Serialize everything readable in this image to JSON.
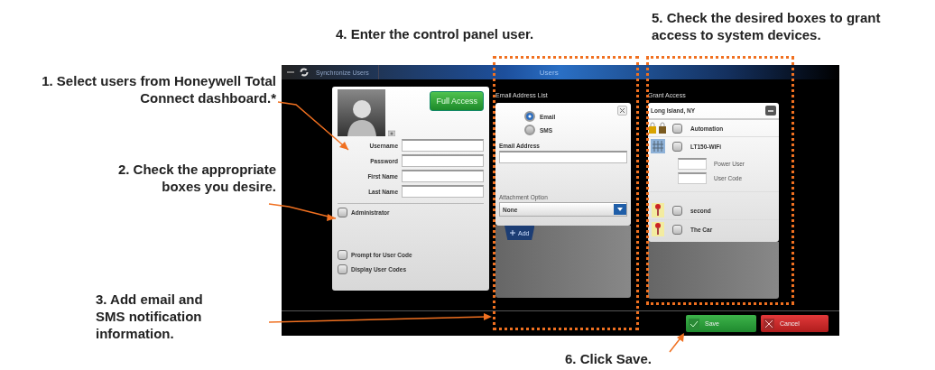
{
  "callouts": [
    {
      "text": "1. Select users from Honeywell Total Connect dashboard.*"
    },
    {
      "text": "2. Check the appropriate boxes you desire."
    },
    {
      "text": "3. Add email and SMS notification information."
    },
    {
      "text": "4. Enter the control panel user."
    },
    {
      "text": "5. Check the desired boxes to grant access to system devices."
    },
    {
      "text": "6. Click Save."
    }
  ],
  "screen": {
    "title_bar": {
      "tab": "Synchronize Users",
      "title": "Users"
    },
    "user_panel": {
      "access_button": "Full Access",
      "fields": [
        {
          "label": "Username"
        },
        {
          "label": "Password"
        },
        {
          "label": "First Name"
        },
        {
          "label": "Last Name"
        }
      ],
      "checkboxes": [
        {
          "label": "Administrator",
          "checked": false
        },
        {
          "label": "Prompt for User Code",
          "checked": false
        },
        {
          "label": "Display User Codes",
          "checked": false
        }
      ]
    },
    "email_panel": {
      "heading": "Email Address List",
      "radios": [
        {
          "label": "Email",
          "selected": true
        },
        {
          "label": "SMS",
          "selected": false
        }
      ],
      "address_label": "Email Address",
      "attachment_label": "Attachment Option",
      "attachment_value": "None",
      "add_button": "Add"
    },
    "grant_panel": {
      "heading": "Grant Access",
      "location": "Long Island, NY",
      "devices": [
        {
          "kind": "lock",
          "name": "Automation",
          "checked": false
        },
        {
          "kind": "keypad",
          "name": "LT150-WiFi",
          "checked": false,
          "inputs": [
            {
              "label": "Power User"
            },
            {
              "label": "User Code"
            }
          ]
        },
        {
          "kind": "car",
          "name": "second",
          "checked": false
        },
        {
          "kind": "car",
          "name": "The Car",
          "checked": false
        }
      ]
    },
    "footer": {
      "save": "Save",
      "cancel": "Cancel"
    }
  }
}
